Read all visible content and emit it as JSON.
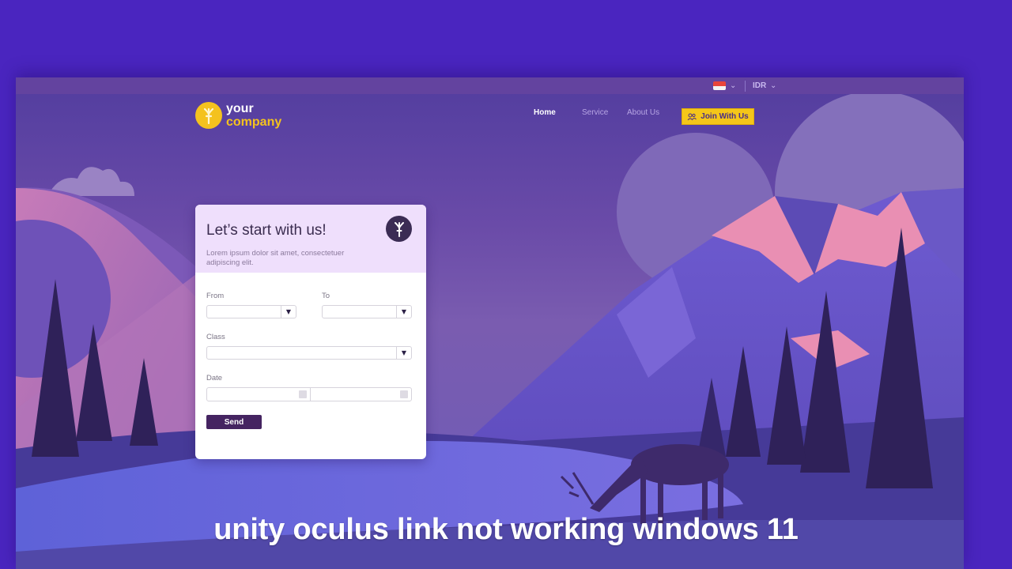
{
  "topbar": {
    "language_flag": "indonesia-flag",
    "currency": "IDR"
  },
  "logo": {
    "line1": "your",
    "line2": "company"
  },
  "nav": {
    "items": [
      {
        "label": "Home",
        "active": true
      },
      {
        "label": "Service",
        "active": false
      },
      {
        "label": "About Us",
        "active": false
      }
    ],
    "join_button": "Join With Us"
  },
  "form_card": {
    "title": "Let’s start with us!",
    "subtitle": "Lorem ipsum dolor sit amet, consectetuer adipiscing elit.",
    "from_label": "From",
    "from_value": "",
    "to_label": "To",
    "to_value": "",
    "class_label": "Class",
    "class_value": "",
    "date_label": "Date",
    "date_start": "",
    "date_end": "",
    "send_button": "Send"
  },
  "caption": "unity oculus link not working windows 11",
  "colors": {
    "page_background": "#4a25bf",
    "accent_yellow": "#f5c619",
    "send_button": "#452461",
    "mountain_pink": "#e98fb3",
    "tree_dark": "#2f2159"
  }
}
